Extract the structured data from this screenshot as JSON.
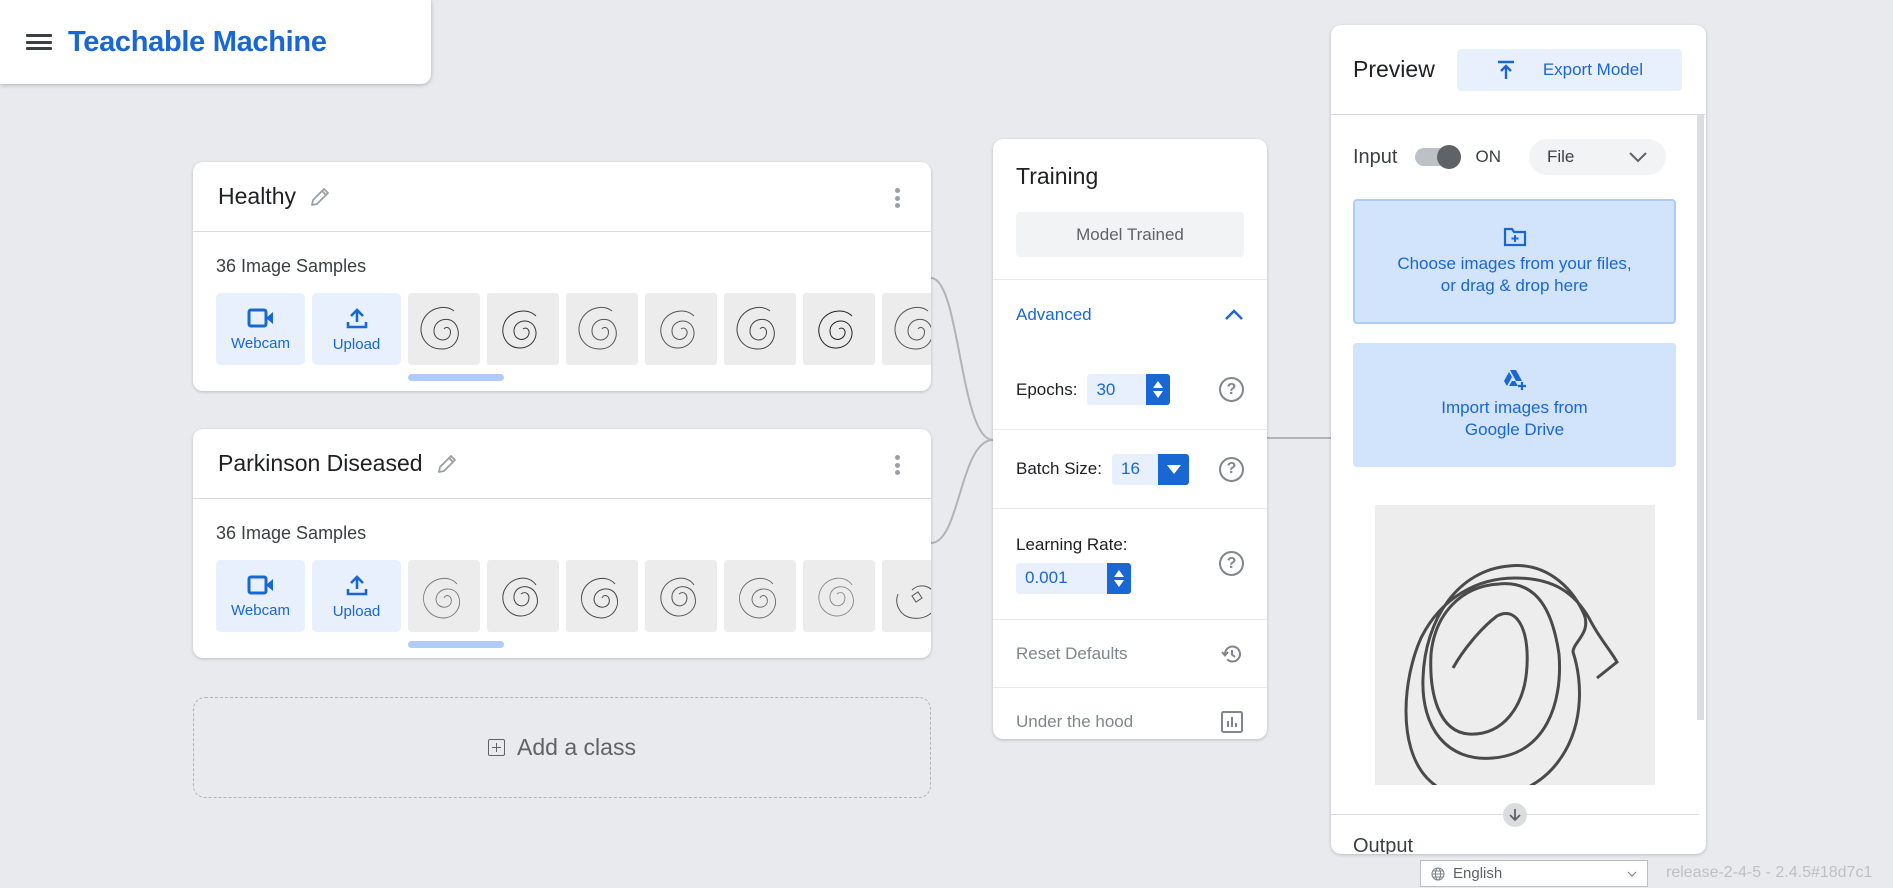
{
  "header": {
    "title": "Teachable Machine",
    "menu_icon": "hamburger-menu-icon"
  },
  "classes": [
    {
      "name": "Healthy",
      "sample_count": "36 Image Samples",
      "buttons": [
        {
          "label": "Webcam",
          "icon": "webcam-icon"
        },
        {
          "label": "Upload",
          "icon": "upload-icon"
        }
      ],
      "visible_thumbnails": 7
    },
    {
      "name": "Parkinson Diseased",
      "sample_count": "36 Image Samples",
      "buttons": [
        {
          "label": "Webcam",
          "icon": "webcam-icon"
        },
        {
          "label": "Upload",
          "icon": "upload-icon"
        }
      ],
      "visible_thumbnails": 7
    }
  ],
  "add_class": {
    "label": "Add a class"
  },
  "training": {
    "title": "Training",
    "train_button": "Model Trained",
    "advanced_label": "Advanced",
    "advanced_expanded": true,
    "epochs": {
      "label": "Epochs:",
      "value": "30"
    },
    "batch_size": {
      "label": "Batch Size:",
      "value": "16"
    },
    "learning_rate": {
      "label": "Learning Rate:",
      "value": "0.001"
    },
    "help_glyph": "?",
    "reset_label": "Reset Defaults",
    "under_hood_label": "Under the hood"
  },
  "preview": {
    "title": "Preview",
    "export_label": "Export Model",
    "input_label": "Input",
    "input_state": "ON",
    "input_source": "File",
    "drop_zone_text_1": "Choose images from your files,",
    "drop_zone_text_2": "or drag & drop here",
    "drive_text_1": "Import images from",
    "drive_text_2": "Google Drive",
    "output_label": "Output"
  },
  "footer": {
    "language": "English",
    "version": "release-2-4-5 - 2.4.5#18d7c1"
  },
  "colors": {
    "accent": "#1967d2",
    "accent_light": "#e8f0fe",
    "background": "#e8eaed"
  }
}
